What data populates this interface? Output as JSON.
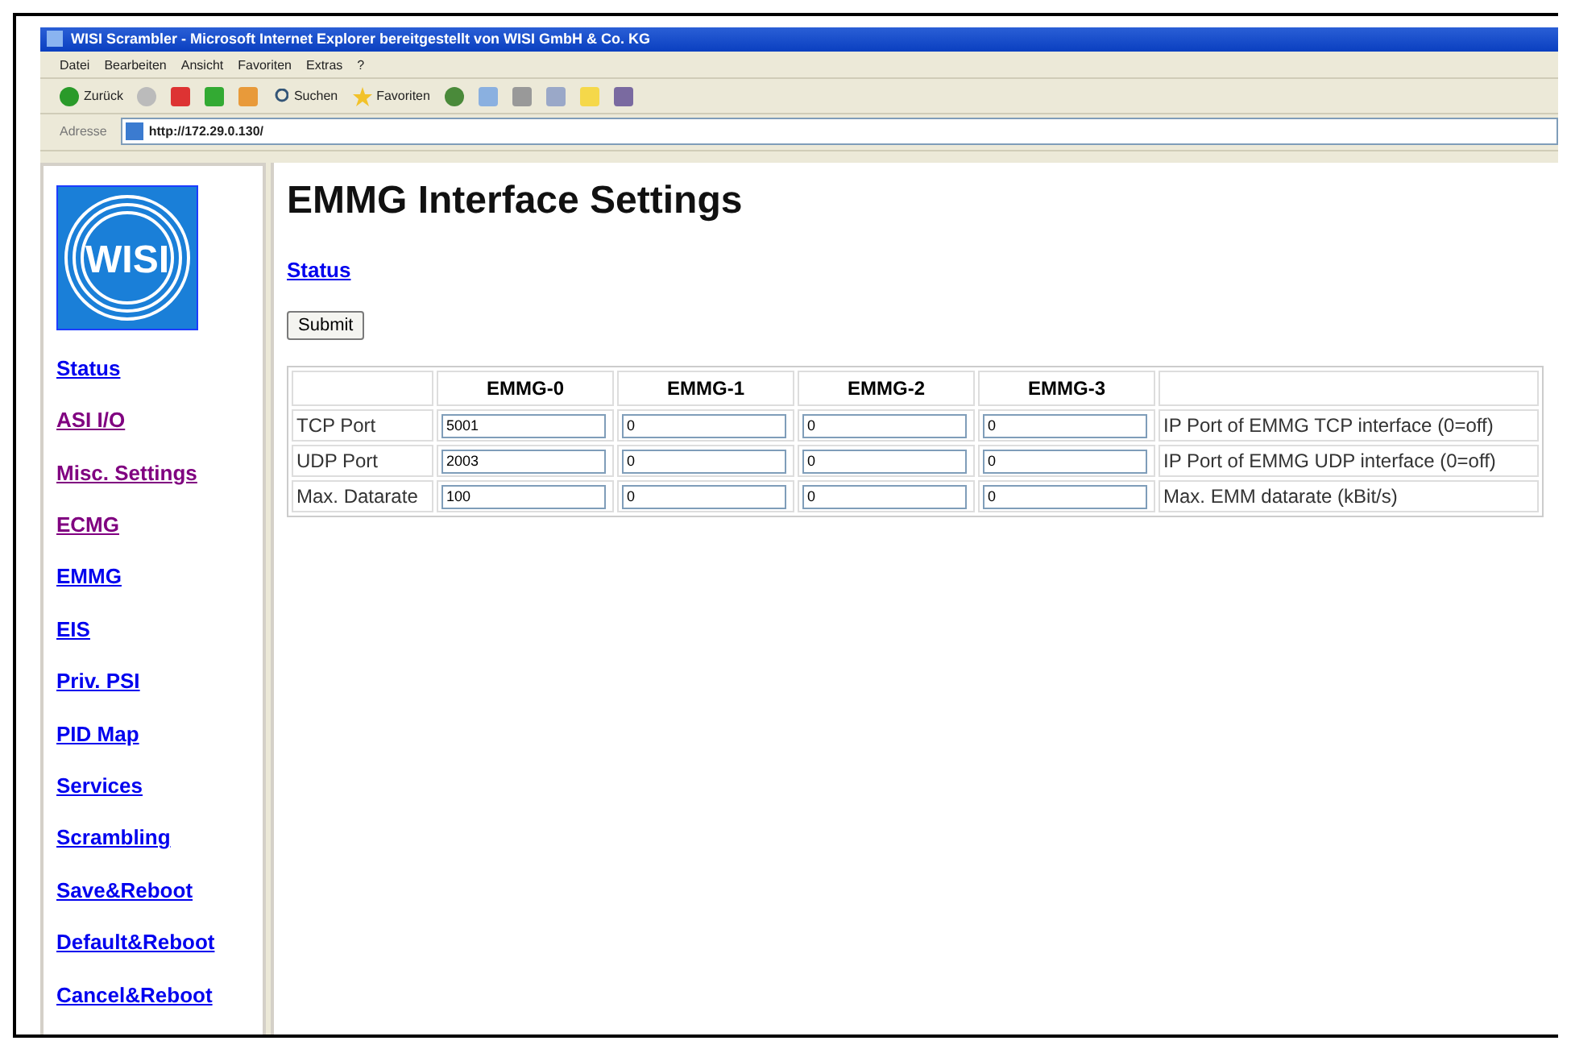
{
  "window": {
    "title": "WISI Scrambler - Microsoft Internet Explorer bereitgestellt von WISI GmbH & Co. KG"
  },
  "menu": [
    "Datei",
    "Bearbeiten",
    "Ansicht",
    "Favoriten",
    "Extras",
    "?"
  ],
  "toolbar": {
    "back": "Zurück",
    "search": "Suchen",
    "favorites": "Favoriten"
  },
  "address": {
    "label": "Adresse",
    "url": "http://172.29.0.130/"
  },
  "logo": {
    "text": "WISI"
  },
  "sidebar": {
    "items": [
      {
        "label": "Status",
        "visited": false
      },
      {
        "label": "ASI I/O",
        "visited": true
      },
      {
        "label": "Misc. Settings",
        "visited": true
      },
      {
        "label": "ECMG",
        "visited": true
      },
      {
        "label": "EMMG",
        "visited": false
      },
      {
        "label": "EIS",
        "visited": false
      },
      {
        "label": "Priv. PSI",
        "visited": false
      },
      {
        "label": "PID Map",
        "visited": false
      },
      {
        "label": "Services",
        "visited": false
      },
      {
        "label": "Scrambling",
        "visited": false
      },
      {
        "label": "Save&Reboot",
        "visited": false
      },
      {
        "label": "Default&Reboot",
        "visited": false
      },
      {
        "label": "Cancel&Reboot",
        "visited": false
      }
    ]
  },
  "page": {
    "title": "EMMG Interface Settings",
    "status_link": "Status",
    "submit": "Submit"
  },
  "table": {
    "columns": [
      "EMMG-0",
      "EMMG-1",
      "EMMG-2",
      "EMMG-3"
    ],
    "rows": [
      {
        "label": "TCP Port",
        "values": [
          "5001",
          "0",
          "0",
          "0"
        ],
        "description": "IP Port of EMMG TCP interface (0=off)"
      },
      {
        "label": "UDP Port",
        "values": [
          "2003",
          "0",
          "0",
          "0"
        ],
        "description": "IP Port of EMMG UDP interface (0=off)"
      },
      {
        "label": "Max. Datarate",
        "values": [
          "100",
          "0",
          "0",
          "0"
        ],
        "description": "Max. EMM datarate (kBit/s)"
      }
    ]
  }
}
